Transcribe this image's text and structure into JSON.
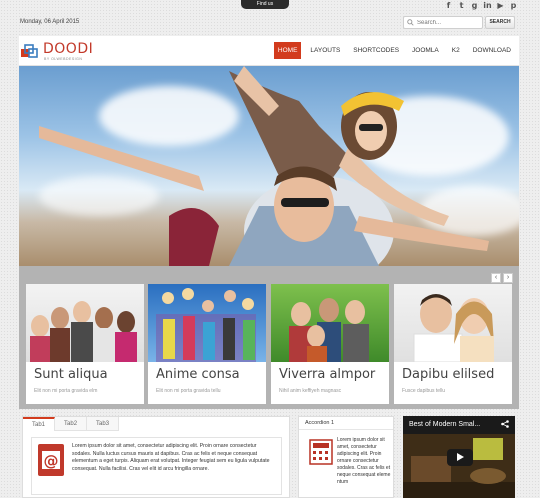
{
  "topbar": {
    "findus": "Find us",
    "date": "Monday, 06 April 2015",
    "search_placeholder": "Search...",
    "search_button": "SEARCH",
    "social_icons": [
      "facebook-icon",
      "twitter-icon",
      "googleplus-icon",
      "linkedin-icon",
      "youtube-icon",
      "pinterest-icon"
    ]
  },
  "header": {
    "logo": "DOODI",
    "logo_sub": "BY OLWEBDESIGN",
    "nav": [
      {
        "label": "HOME",
        "active": true
      },
      {
        "label": "LAYOUTS",
        "active": false
      },
      {
        "label": "SHORTCODES",
        "active": false
      },
      {
        "label": "JOOMLA",
        "active": false
      },
      {
        "label": "K2",
        "active": false
      },
      {
        "label": "DOWNLOAD",
        "active": false
      }
    ]
  },
  "slider": {
    "prev": "‹",
    "next": "›",
    "cards": [
      {
        "title": "Sunt aliqua",
        "desc": "Elit non mi porta gravida elm"
      },
      {
        "title": "Anime consa",
        "desc": "Elit non mi porta gravida tellu"
      },
      {
        "title": "Viverra almpor",
        "desc": "Nihil anim keffiyeh magnasc"
      },
      {
        "title": "Dapibu elilsed",
        "desc": "Fusce dapibus tellu"
      }
    ]
  },
  "tabs": {
    "items": [
      {
        "label": "Tab1",
        "active": true
      },
      {
        "label": "Tab2",
        "active": false
      },
      {
        "label": "Tab3",
        "active": false
      }
    ],
    "content": "Lorem ipsum dolor sit amet, consectetur adipiscing elit. Proin ornare consectetur sodales. Nulla luctus cursus mauris at dapibus. Cras ac felis et neque consequat elementum a eget turpis. Aliquam erat volutpat. Integer feugiat sem eu ligula vulputate consequat. Nulla facilisi. Cras vel elit id arcu fringilla ornare."
  },
  "accordion": {
    "title": "Accordion 1",
    "content": "Lorem ipsum dolor sit amet, consectetur adipiscing elit. Proin ornare consectetur sodales. Cras ac felis et neque consequat eleme ntum"
  },
  "video": {
    "title": "Best of Modern Smal..."
  },
  "colors": {
    "accent": "#d23b1d",
    "slider_bg": "#b3b3b3"
  }
}
